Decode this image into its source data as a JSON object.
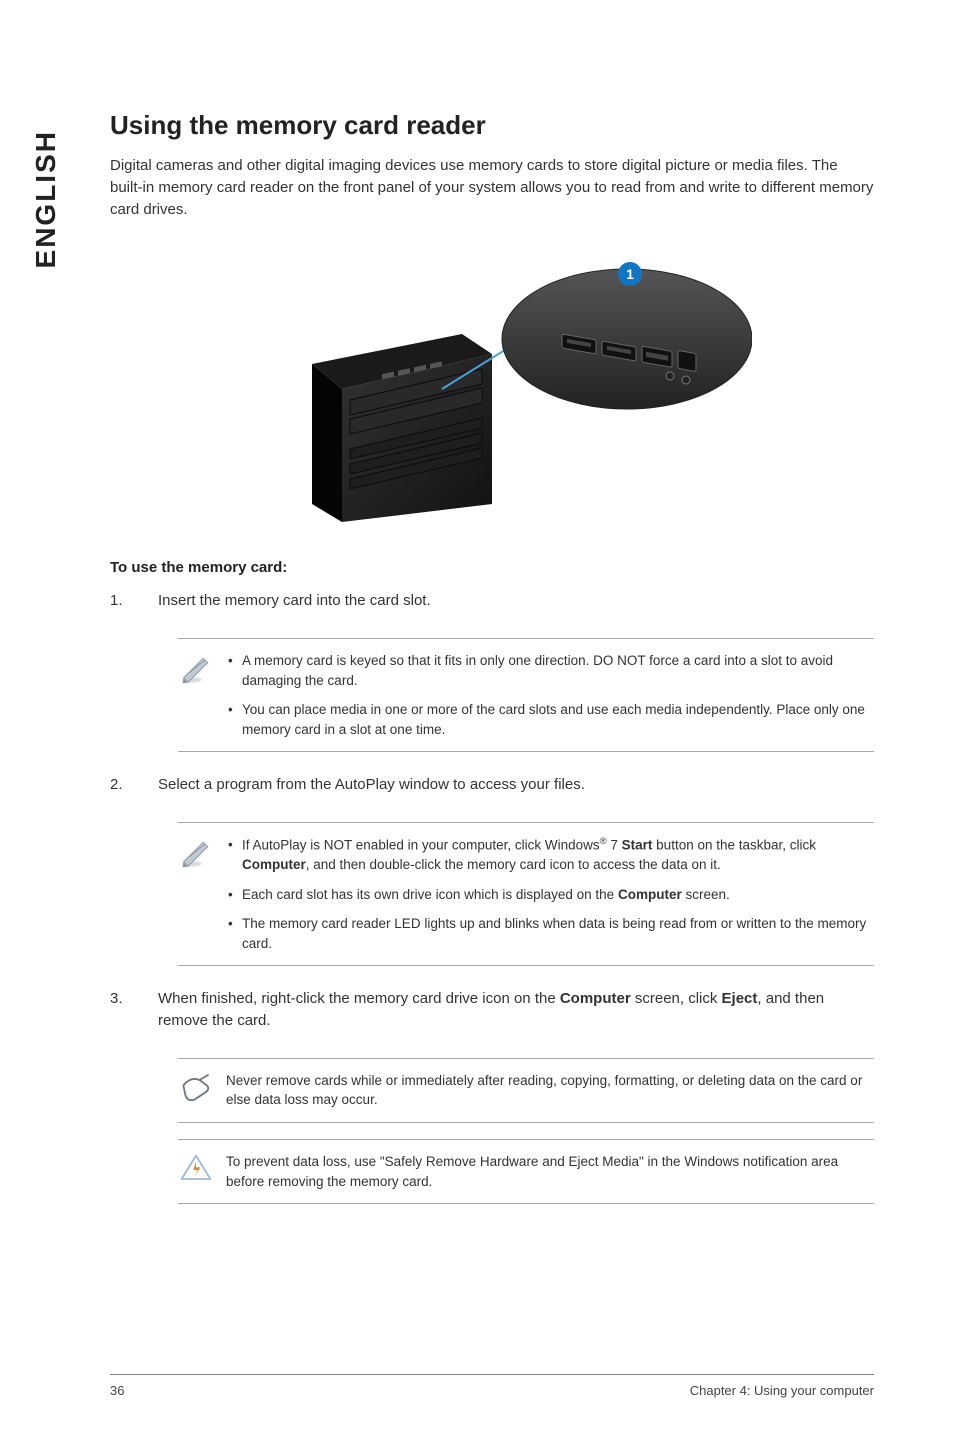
{
  "side_tab": "ENGLISH",
  "title": "Using the memory card reader",
  "intro": "Digital cameras and other digital imaging devices use memory cards to store digital picture or media files. The built-in memory card reader on the front panel of your system allows you to read from and write to different memory card drives.",
  "callout": "1",
  "step_heading": "To use the memory card:",
  "steps": {
    "s1": "Insert the memory card into the card slot.",
    "s2": "Select a program from the AutoPlay window to access your files.",
    "s3_a": "When finished, right-click the memory card drive icon on the ",
    "s3_computer": "Computer",
    "s3_b": " screen, click ",
    "s3_eject": "Eject",
    "s3_c": ", and then remove the card."
  },
  "note1": {
    "b1": "A memory card is keyed so that it fits in only one direction. DO NOT force a card into a slot to avoid damaging the card.",
    "b2": "You can place media in one or more of the card slots and use each media independently. Place only one memory card in a slot at one time."
  },
  "note2": {
    "b1_a": "If AutoPlay is NOT enabled in your computer, click Windows",
    "b1_reg": "®",
    "b1_b": " 7 ",
    "b1_start": "Start",
    "b1_c": " button on the taskbar, click ",
    "b1_comp": "Computer",
    "b1_d": ", and then double-click the memory card icon to access the data on it.",
    "b2_a": "Each card slot has its own drive icon which is displayed on the ",
    "b2_comp": "Computer",
    "b2_b": " screen.",
    "b3": "The memory card reader LED lights up and blinks when data is being read from or written to the memory card."
  },
  "note3": "Never remove cards while or immediately after reading, copying, formatting, or deleting data on the card or else data loss may occur.",
  "note4": "To prevent data loss, use \"Safely Remove Hardware and Eject Media\" in the Windows notification area before removing the memory card.",
  "footer": {
    "page": "36",
    "chapter": "Chapter 4: Using your computer"
  }
}
